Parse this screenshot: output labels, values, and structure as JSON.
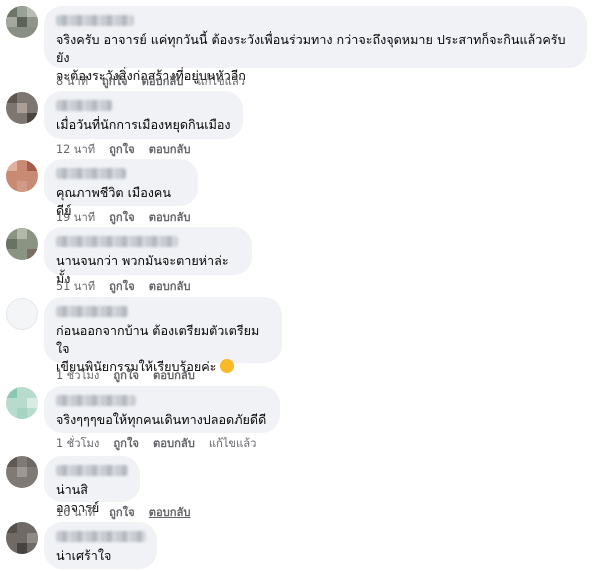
{
  "comments": [
    {
      "text": "จริงครับ อาจารย์ แค่ทุกวันนี้ ต้องระวังเพื่อนร่วมทาง กว่าจะถึงจุดหมาย ประสาทก็จะกินแล้วครับ ยัง\nจะต้องระวังสิ่งก่อสร้างที่อยู่บนหัวอีก",
      "time": "8 นาที",
      "like": "ถูกใจ",
      "reply": "ตอบกลับ",
      "edited": "แก้ไขแล้ว"
    },
    {
      "text": "เมื่อวันที่นักการเมืองหยุดกินเมือง",
      "time": "12 นาที",
      "like": "ถูกใจ",
      "reply": "ตอบกลับ"
    },
    {
      "text": "คุณภาพชีวิต เมืองคนดีย์",
      "time": "19 นาที",
      "like": "ถูกใจ",
      "reply": "ตอบกลับ"
    },
    {
      "text": "นานจนกว่า พวกมันจะตายห่าล่ะมั้ง",
      "time": "51 นาที",
      "like": "ถูกใจ",
      "reply": "ตอบกลับ"
    },
    {
      "text": "ก่อนออกจากบ้าน ต้องเตรียมตัวเตรียมใจ\nเขียนพินัยกรรมให้เรียบร้อยค่ะ",
      "emoji": "😔",
      "time": "1 ชั่วโมง",
      "like": "ถูกใจ",
      "reply": "ตอบกลับ"
    },
    {
      "text": "จริงๆๆๆขอให้ทุกคนเดินทางปลอดภัยดีดี",
      "time": "1 ชั่วโมง",
      "like": "ถูกใจ",
      "reply": "ตอบกลับ",
      "edited": "แก้ไขแล้ว"
    },
    {
      "text": "น่านสิ อาจารย์",
      "time": "16 นาที",
      "like": "ถูกใจ",
      "reply": "ตอบกลับ"
    },
    {
      "text": "น่าเศร้าใจ"
    }
  ]
}
